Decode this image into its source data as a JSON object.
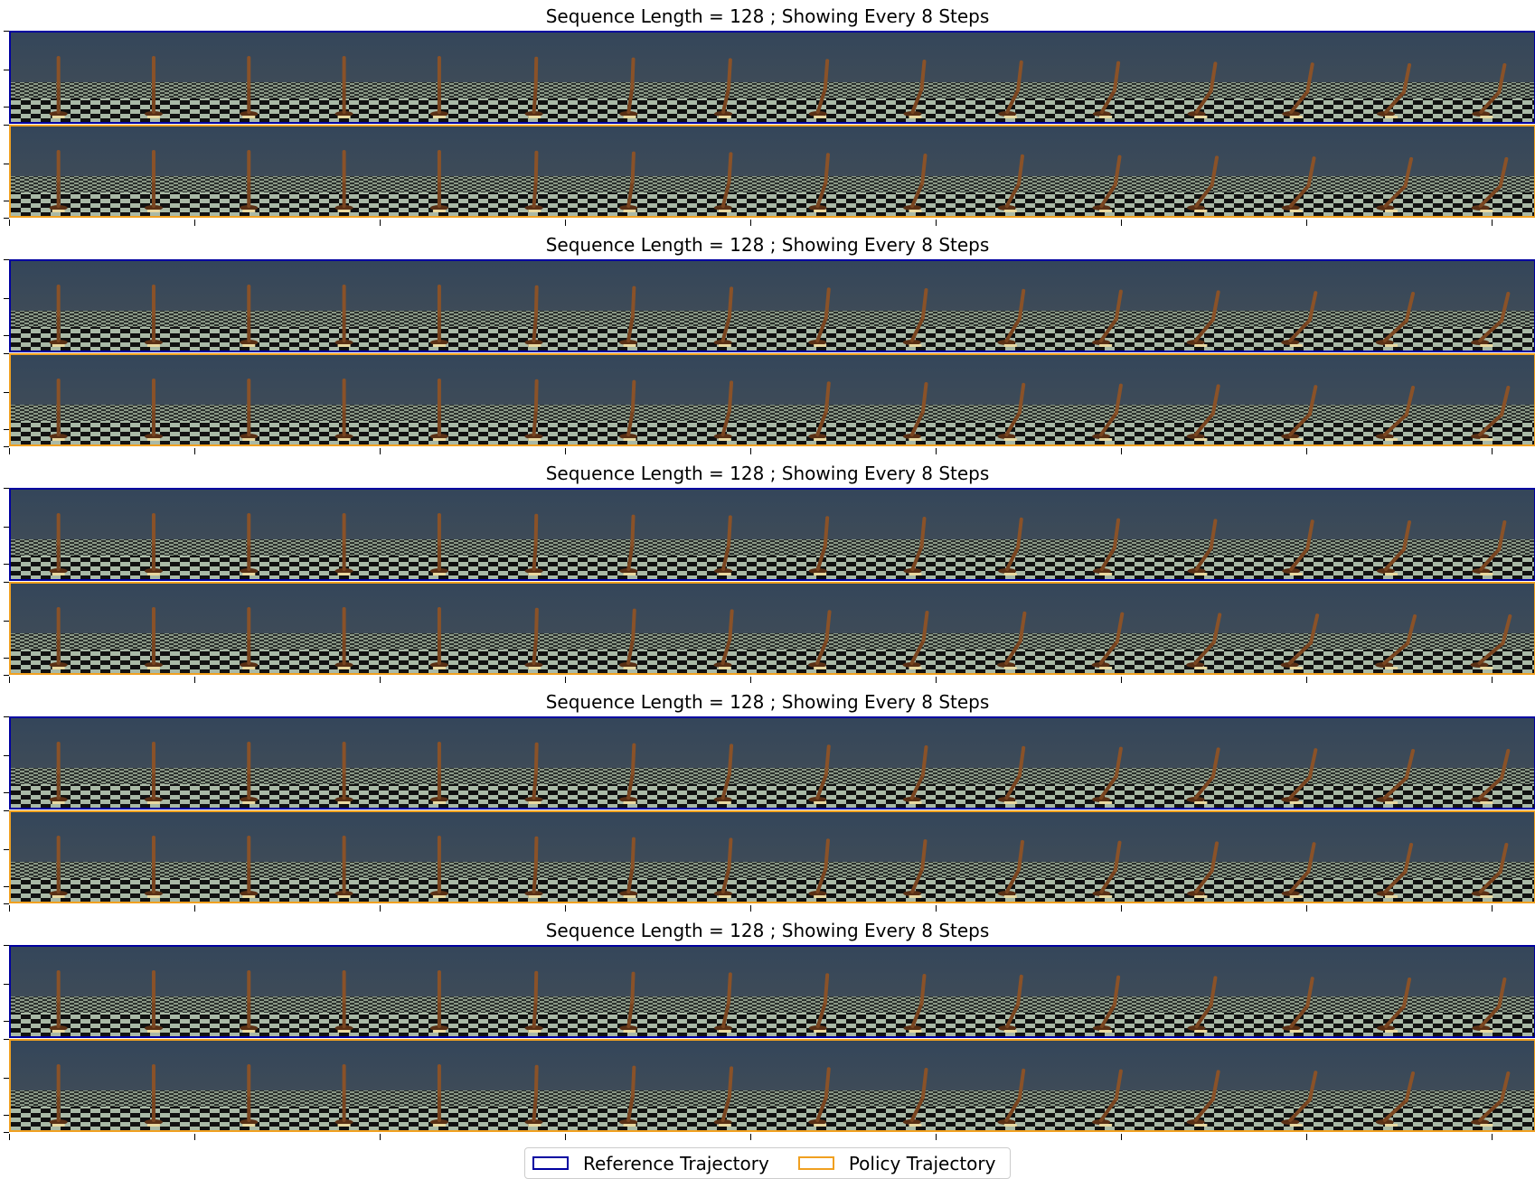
{
  "panels": [
    {
      "title": "Sequence Length = 128 ; Showing Every 8 Steps"
    },
    {
      "title": "Sequence Length = 128 ; Showing Every 8 Steps"
    },
    {
      "title": "Sequence Length = 128 ; Showing Every 8 Steps"
    },
    {
      "title": "Sequence Length = 128 ; Showing Every 8 Steps"
    },
    {
      "title": "Sequence Length = 128 ; Showing Every 8 Steps"
    }
  ],
  "legend": {
    "reference_label": "Reference Trajectory",
    "policy_label": "Policy Trajectory"
  },
  "colors": {
    "reference": "#0000a0",
    "policy": "#f0a020",
    "sky": "#3b4a5c",
    "floor_light": "#a9b9a6",
    "floor_dark": "#111111",
    "robot": "#7a4520"
  },
  "frames_per_strip": 16
}
